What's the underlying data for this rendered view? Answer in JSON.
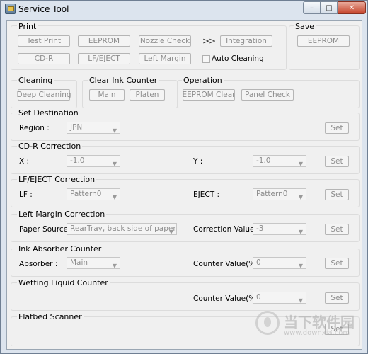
{
  "window": {
    "title": "Service Tool",
    "icon": "printer-app-icon",
    "caption": {
      "minimize": "–",
      "maximize": "□",
      "close": "✕"
    }
  },
  "print": {
    "title": "Print",
    "buttons": {
      "test_print": "Test Print",
      "eeprom": "EEPROM",
      "nozzle_check": "Nozzle Check",
      "cd_r": "CD-R",
      "lf_eject": "LF/EJECT",
      "left_margin": "Left Margin",
      "integration": "Integration"
    },
    "chevron": ">>",
    "auto_cleaning": "Auto Cleaning"
  },
  "save": {
    "title": "Save",
    "eeprom": "EEPROM"
  },
  "cleaning": {
    "title": "Cleaning",
    "deep_cleaning": "Deep Cleaning"
  },
  "clear_ink": {
    "title": "Clear Ink Counter",
    "main": "Main",
    "platen": "Platen"
  },
  "operation": {
    "title": "Operation",
    "eeprom_clear": "EEPROM Clear",
    "panel_check": "Panel Check"
  },
  "set_destination": {
    "title": "Set Destination",
    "region_label": "Region :",
    "region_value": "JPN",
    "set": "Set"
  },
  "cdr_correction": {
    "title": "CD-R Correction",
    "x_label": "X :",
    "x_value": "-1.0",
    "y_label": "Y :",
    "y_value": "-1.0",
    "set": "Set"
  },
  "lf_eject_correction": {
    "title": "LF/EJECT Correction",
    "lf_label": "LF :",
    "lf_value": "Pattern0",
    "eject_label": "EJECT :",
    "eject_value": "Pattern0",
    "set": "Set"
  },
  "left_margin_correction": {
    "title": "Left Margin Correction",
    "paper_source_label": "Paper Source :",
    "paper_source_value": "RearTray, back side of paper",
    "correction_label": "Correction Value :",
    "correction_value": "-3",
    "set": "Set"
  },
  "ink_absorber": {
    "title": "Ink Absorber Counter",
    "absorber_label": "Absorber :",
    "absorber_value": "Main",
    "counter_label": "Counter Value(%) :",
    "counter_value": "0",
    "set": "Set"
  },
  "wetting_liquid": {
    "title": "Wetting Liquid Counter",
    "counter_label": "Counter Value(%) :",
    "counter_value": "0",
    "set": "Set"
  },
  "flatbed": {
    "title": "Flatbed Scanner",
    "set": "Set"
  },
  "watermark": {
    "brand": "当下软件园",
    "url": "www.downxia.com"
  }
}
